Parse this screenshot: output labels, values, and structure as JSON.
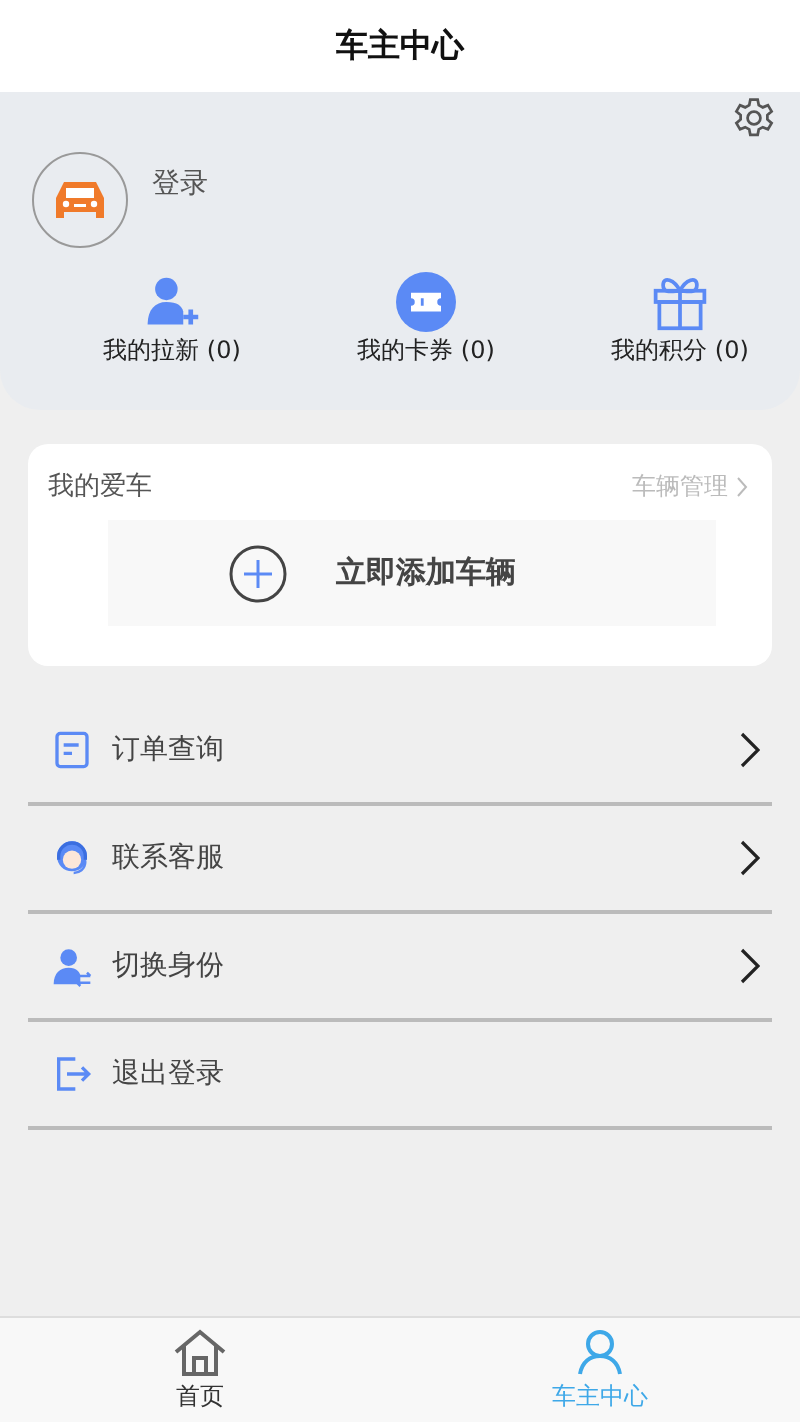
{
  "header": {
    "title": "车主中心"
  },
  "profile": {
    "login": "登录"
  },
  "stats": [
    {
      "kind": "invite",
      "label": "我的拉新 (0)"
    },
    {
      "kind": "coupon",
      "label": "我的卡券 (0)"
    },
    {
      "kind": "points",
      "label": "我的积分 (0)"
    }
  ],
  "car_card": {
    "title": "我的爱车",
    "manage_link": "车辆管理",
    "add_button": "立即添加车辆"
  },
  "menu": [
    {
      "kind": "orders",
      "label": "订单查询",
      "arrow": true
    },
    {
      "kind": "service",
      "label": "联系客服",
      "arrow": true
    },
    {
      "kind": "switch",
      "label": "切换身份",
      "arrow": true
    },
    {
      "kind": "logout",
      "label": "退出登录",
      "arrow": false
    }
  ],
  "tabs": [
    {
      "kind": "home",
      "label": "首页",
      "selected": false
    },
    {
      "kind": "user",
      "label": "车主中心",
      "selected": true
    }
  ]
}
